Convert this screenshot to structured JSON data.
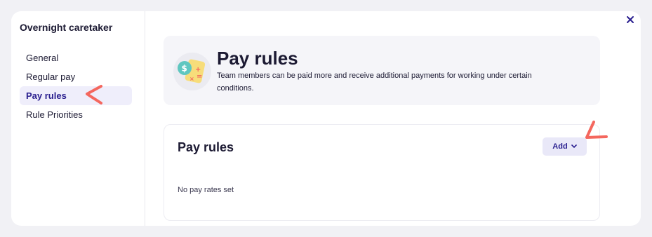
{
  "sidebar": {
    "title": "Overnight caretaker",
    "items": [
      {
        "label": "General",
        "active": false
      },
      {
        "label": "Regular pay",
        "active": false
      },
      {
        "label": "Pay rules",
        "active": true
      },
      {
        "label": "Rule Priorities",
        "active": false
      }
    ]
  },
  "header": {
    "title": "Pay rules",
    "description": "Team members can be paid more and receive additional payments for working under certain conditions.",
    "illustration": "calculator-coin-icon",
    "close_icon": "close-icon"
  },
  "card": {
    "title": "Pay rules",
    "add_label": "Add",
    "add_icon": "chevron-down-icon",
    "empty_text": "No pay rates set"
  },
  "colors": {
    "accent": "#2b2090",
    "active_bg": "#efeefb",
    "annotation": "#f4675e"
  }
}
